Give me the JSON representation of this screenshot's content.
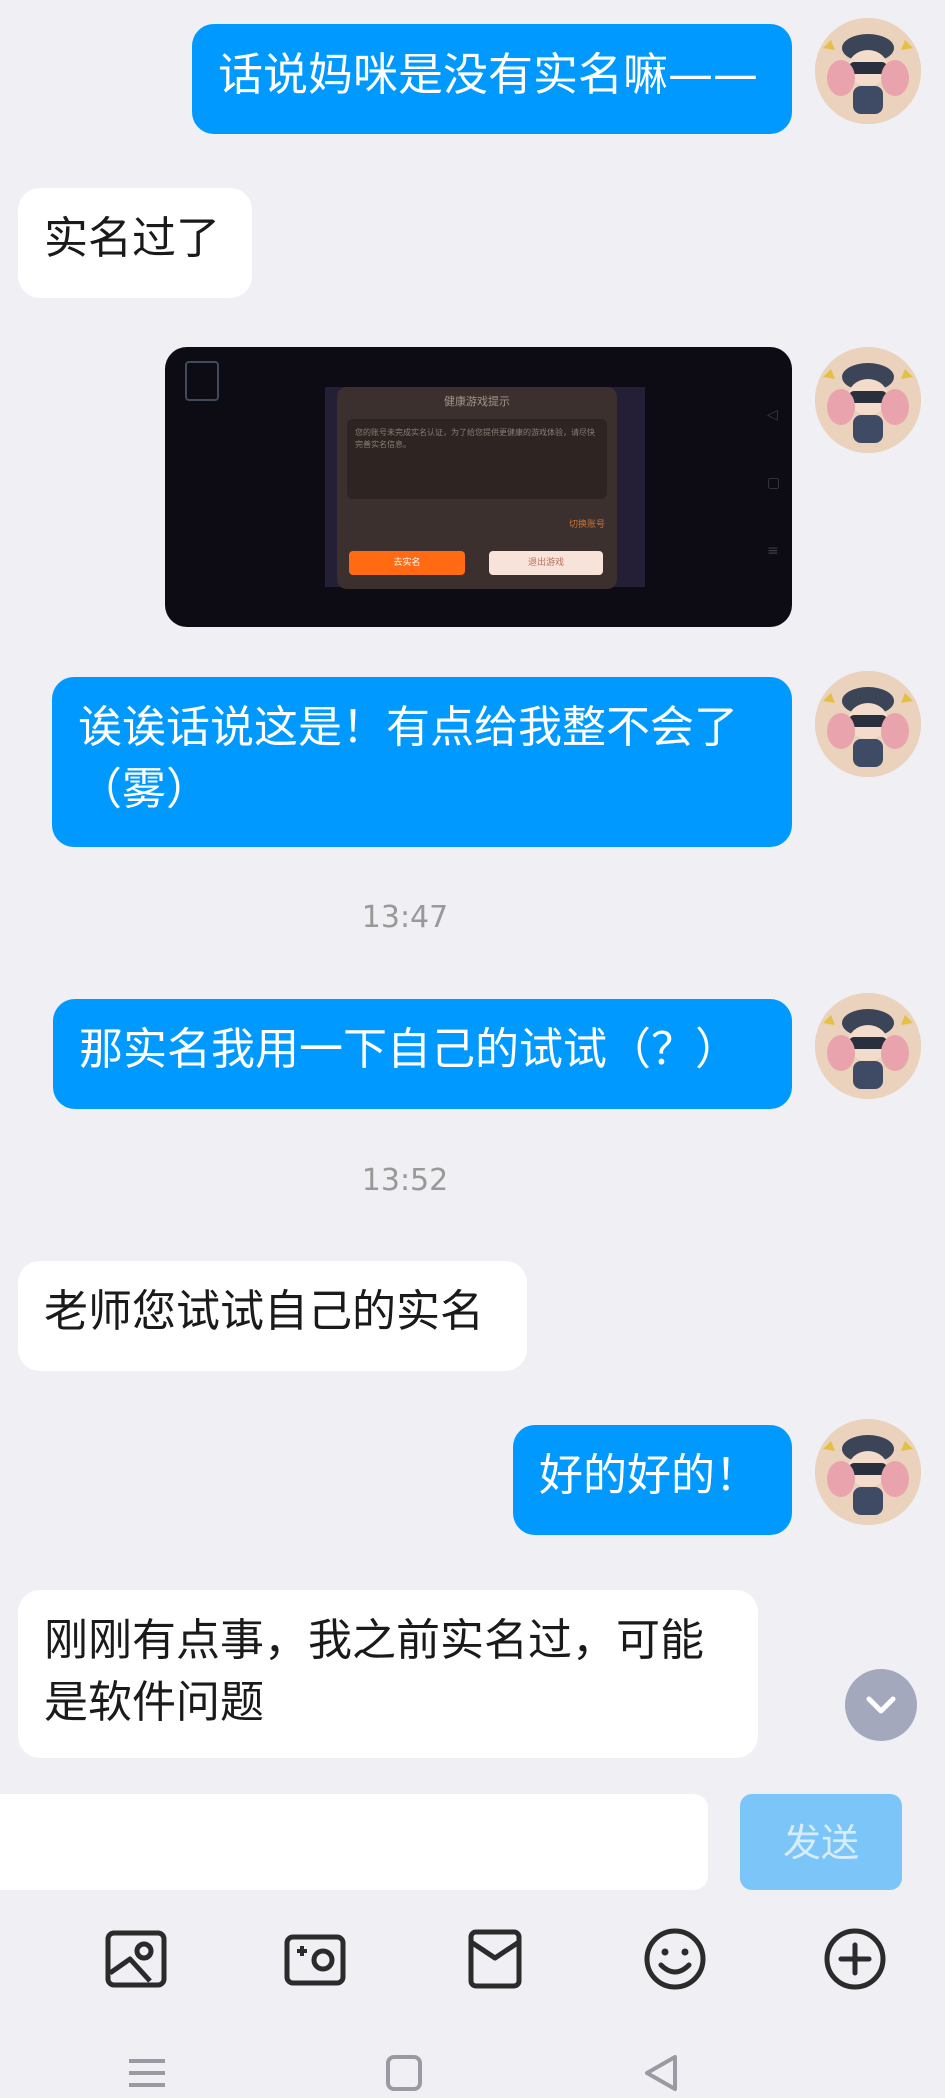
{
  "messages": [
    {
      "dir": "out",
      "text": "话说妈咪是没有实名嘛——"
    },
    {
      "dir": "in",
      "text": "实名过了"
    },
    {
      "dir": "out",
      "type": "image",
      "image": {
        "dialog_title": "健康游戏提示",
        "dialog_body": "您的账号未完成实名认证，为了给您提供更健康的游戏体验，请尽快完善实名信息。",
        "switch_account": "切换账号",
        "verify_button": "去实名",
        "exit_button": "退出游戏"
      }
    },
    {
      "dir": "out",
      "text": "诶诶话说这是！有点给我整不会了（雾）"
    },
    {
      "type": "time",
      "text": "13:47"
    },
    {
      "dir": "out",
      "text": "那实名我用一下自己的试试（？）"
    },
    {
      "type": "time",
      "text": "13:52"
    },
    {
      "dir": "in",
      "text": "老师您试试自己的实名"
    },
    {
      "dir": "out",
      "text": "好的好的！"
    },
    {
      "dir": "in",
      "text": "刚刚有点事，我之前实名过，可能是软件问题"
    }
  ],
  "input": {
    "placeholder": "",
    "value": ""
  },
  "send_label": "发送",
  "toolbar": [
    "image-icon",
    "camera-icon",
    "red-packet-icon",
    "emoji-icon",
    "plus-icon"
  ],
  "navbar": [
    "menu-icon",
    "home-icon",
    "back-icon"
  ],
  "colors": {
    "outgoing": "#0099ff",
    "incoming": "#ffffff",
    "background": "#efeff4",
    "send_disabled": "#7cc5f8"
  }
}
